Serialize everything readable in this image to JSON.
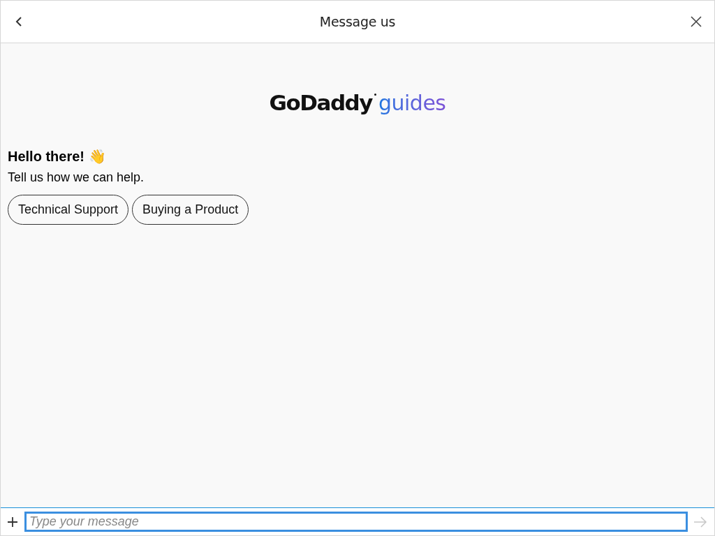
{
  "header": {
    "title": "Message us"
  },
  "logo": {
    "brand": "GoDaddy",
    "product": "guides"
  },
  "greeting": {
    "title": "Hello there! 👋",
    "subtitle": "Tell us how we can help."
  },
  "options": [
    {
      "label": "Technical Support"
    },
    {
      "label": "Buying a Product"
    }
  ],
  "composer": {
    "placeholder": "Type your message"
  }
}
